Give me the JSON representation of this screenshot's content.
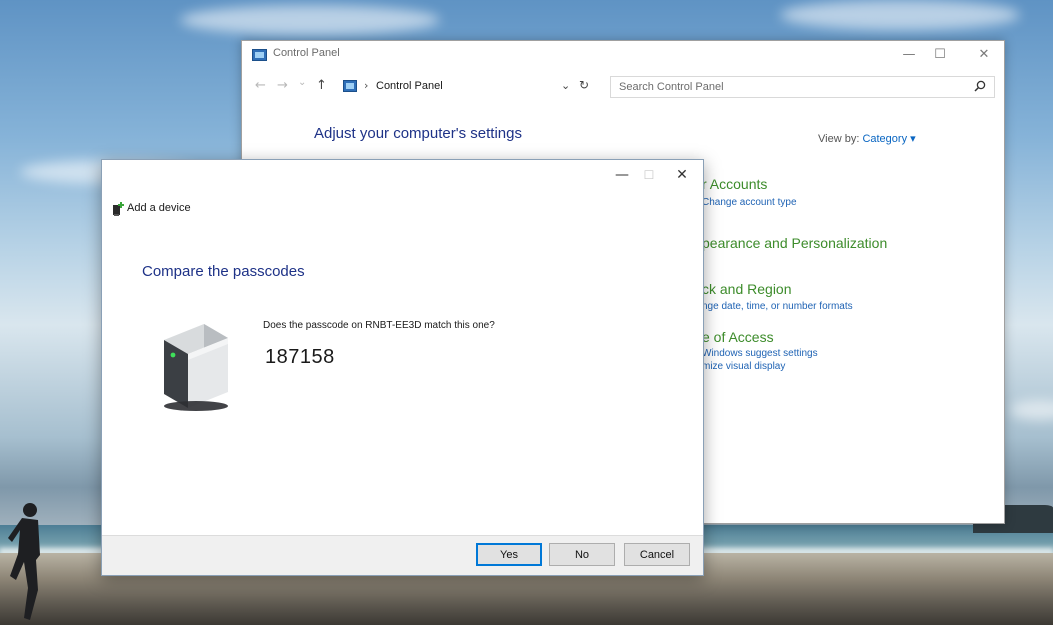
{
  "control_panel": {
    "title": "Control Panel",
    "window_controls": {
      "minimize": "—",
      "maximize": "☐",
      "close": "✕"
    },
    "nav": {
      "back": "←",
      "forward": "→",
      "recent": "⌄",
      "up": "↑"
    },
    "address": {
      "separator": "›",
      "path": "Control Panel",
      "dropdown": "⌄",
      "refresh": "↻"
    },
    "search": {
      "placeholder": "Search Control Panel",
      "icon": "search-icon"
    },
    "heading": "Adjust your computer's settings",
    "view_by": {
      "label": "View by:",
      "value": "Category ▾"
    },
    "categories": [
      {
        "title": "r Accounts",
        "links": [
          "Change account type"
        ]
      },
      {
        "title": "pearance and Personalization",
        "links": []
      },
      {
        "title": "ck and Region",
        "links": [
          "nge date, time, or number formats"
        ]
      },
      {
        "title": "e of Access",
        "links": [
          "Windows suggest settings",
          "mize visual display"
        ]
      }
    ]
  },
  "dialog": {
    "title": "Add a device",
    "window_controls": {
      "minimize": "—",
      "maximize": "☐",
      "close": "✕"
    },
    "heading": "Compare the passcodes",
    "question": "Does the passcode on RNBT-EE3D match this one?",
    "passcode": "187158",
    "buttons": {
      "yes": "Yes",
      "no": "No",
      "cancel": "Cancel"
    }
  }
}
